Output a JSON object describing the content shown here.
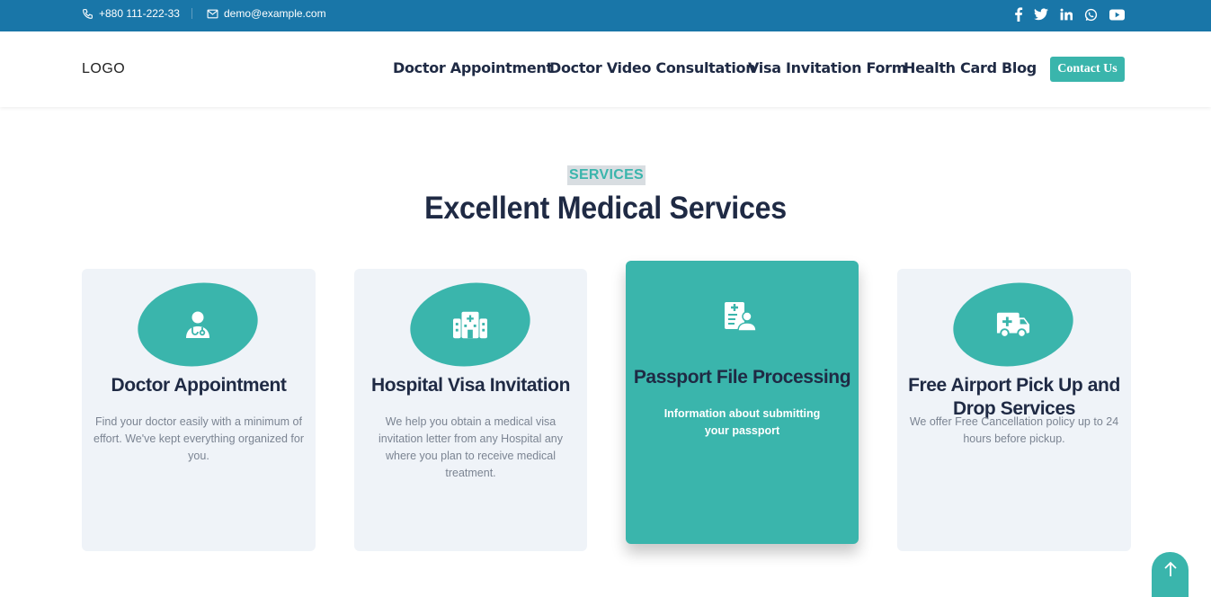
{
  "topbar": {
    "phone": "+880 111-222-33",
    "email": "demo@example.com",
    "socials": [
      "facebook-icon",
      "twitter-icon",
      "linkedin-icon",
      "whatsapp-icon",
      "youtube-icon"
    ]
  },
  "nav": {
    "logo": "LOGO",
    "items": [
      {
        "label": "Doctor Appointment"
      },
      {
        "label": "Doctor Video Consultation"
      },
      {
        "label": "Visa Invitation Form"
      },
      {
        "label": "Health Card"
      },
      {
        "label": "Blog"
      }
    ],
    "contact": "Contact Us"
  },
  "services": {
    "badge": "SERVICES",
    "heading": "Excellent Medical Services",
    "cards": [
      {
        "icon": "doctor-icon",
        "title": "Doctor Appointment",
        "desc": "Find your doctor easily with a minimum of effort. We've kept everything organized for you."
      },
      {
        "icon": "hospital-icon",
        "title": "Hospital Visa Invitation",
        "desc": "We help you obtain a medical visa invitation letter from any Hospital any where you plan to receive medical treatment."
      },
      {
        "icon": "passport-file-icon",
        "title": "Passport File Processing",
        "desc": "Information about submitting your passport"
      },
      {
        "icon": "ambulance-icon",
        "title": "Free Airport Pick Up and Drop Services",
        "desc": "We offer Free Cancellation policy up to 24 hours before pickup."
      }
    ]
  },
  "colors": {
    "topbar": "#1976a8",
    "accent": "#3ab5ac",
    "heading": "#1f2a44",
    "card_bg": "#eff3f8"
  }
}
